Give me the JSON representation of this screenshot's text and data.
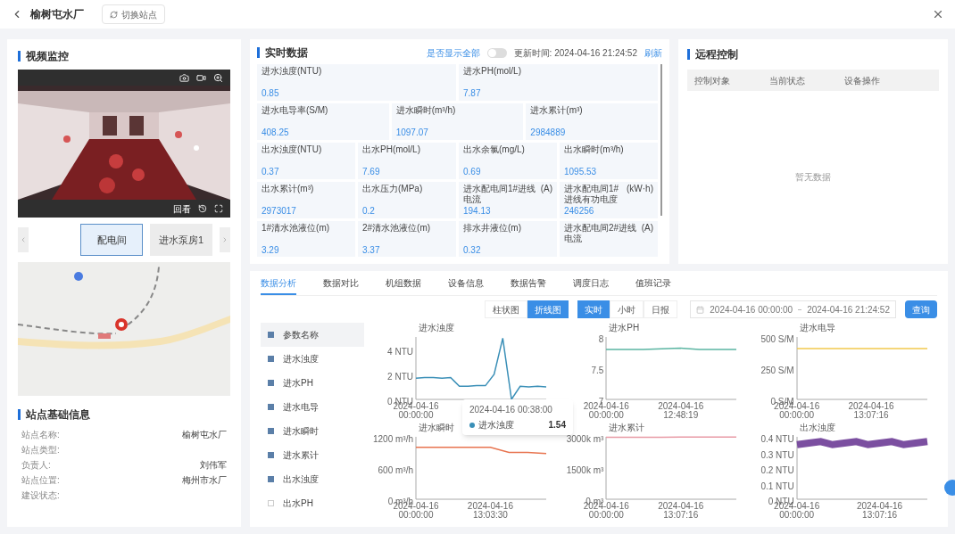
{
  "header": {
    "title": "榆树屯水厂",
    "switch_button": "切换站点"
  },
  "video_panel": {
    "title": "视频监控",
    "playback_label": "回看",
    "cameras": [
      {
        "label": "配电间",
        "selected": true
      },
      {
        "label": "进水泵房1",
        "selected": false
      }
    ]
  },
  "site_info": {
    "title": "站点基础信息",
    "fields": [
      {
        "label": "站点名称:",
        "value": "榆树屯水厂"
      },
      {
        "label": "站点类型:"
      },
      {
        "label": "负责人:",
        "value": "刘伟军"
      },
      {
        "label": "站点位置:",
        "value": "梅州市水厂"
      },
      {
        "label": "建设状态:"
      }
    ]
  },
  "realtime": {
    "title": "实时数据",
    "show_all_label": "是否显示全部",
    "show_all_on": false,
    "update_time": "更新时间: 2024-04-16 21:24:52",
    "refresh": "刷新",
    "items": [
      {
        "label": "进水浊度(NTU)",
        "value": "0.85"
      },
      {
        "label": "进水PH(mol/L)",
        "value": "7.87"
      },
      {
        "label": "进水电导率(S/M)",
        "value": "408.25"
      },
      {
        "label": "进水瞬时(m³/h)",
        "value": "1097.07"
      },
      {
        "label": "进水累计(m³)",
        "value": "2984889"
      },
      {
        "label": "出水浊度(NTU)",
        "value": "0.37"
      },
      {
        "label": "出水PH(mol/L)",
        "value": "7.69"
      },
      {
        "label": "出水余氯(mg/L)",
        "value": "0.69"
      },
      {
        "label": "出水瞬时(m³/h)",
        "value": "1095.53"
      },
      {
        "label": "出水累计(m³)",
        "value": "2973017"
      },
      {
        "label": "出水压力(MPa)",
        "value": "0.2"
      },
      {
        "label": "进水配电间1#进线电流",
        "unit": "(A)",
        "value": "194.13"
      },
      {
        "label": "进水配电间1#进线有功电度",
        "unit": "(kW·h)",
        "value": "246256"
      },
      {
        "label": "1#清水池液位(m)",
        "value": "3.29"
      },
      {
        "label": "2#清水池液位(m)",
        "value": "3.37"
      },
      {
        "label": "排水井液位(m)",
        "value": "0.32"
      },
      {
        "label": "进水配电间2#进线电流",
        "unit": "(A)"
      }
    ]
  },
  "remote_control": {
    "title": "远程控制",
    "columns": [
      "控制对象",
      "当前状态",
      "设备操作"
    ],
    "empty_text": "暂无数据"
  },
  "analysis": {
    "tabs": [
      {
        "label": "数据分析",
        "selected": true
      },
      {
        "label": "数据对比",
        "selected": false
      },
      {
        "label": "机组数据",
        "selected": false
      },
      {
        "label": "设备信息",
        "selected": false
      },
      {
        "label": "数据告警",
        "selected": false
      },
      {
        "label": "调度日志",
        "selected": false
      },
      {
        "label": "值班记录",
        "selected": false
      }
    ],
    "chart_types": [
      {
        "label": "柱状图",
        "selected": false
      },
      {
        "label": "折线图",
        "selected": true
      }
    ],
    "periods": [
      {
        "label": "实时",
        "selected": true
      },
      {
        "label": "小时",
        "selected": false
      },
      {
        "label": "日报",
        "selected": false
      }
    ],
    "date_start": "2024-04-16 00:00:00",
    "date_end": "2024-04-16 21:24:52",
    "query_button": "查询",
    "params_header": {
      "label": "参数名称",
      "checked": true
    },
    "params": [
      {
        "label": "进水浊度",
        "checked": true
      },
      {
        "label": "进水PH",
        "checked": true
      },
      {
        "label": "进水电导",
        "checked": true
      },
      {
        "label": "进水瞬时",
        "checked": true
      },
      {
        "label": "进水累计",
        "checked": true
      },
      {
        "label": "出水浊度",
        "checked": true
      },
      {
        "label": "出水PH",
        "checked": false
      }
    ],
    "charts": [
      {
        "chart_data": {
          "type": "line",
          "categories": [
            "2024-04-16 00:00:00",
            null,
            null,
            null,
            null,
            null,
            null,
            null,
            null,
            null,
            null,
            null,
            null,
            null,
            null,
            null
          ],
          "ylim": [
            0,
            5
          ],
          "yticks": [
            {
              "value": 0,
              "label": "0 NTU"
            },
            {
              "value": 2,
              "label": "2 NTU"
            },
            {
              "value": 4,
              "label": "4 NTU"
            }
          ],
          "series": [
            {
              "name": "进水浊度",
              "color": "#3a8fb7",
              "values": [
                1.7,
                1.75,
                1.75,
                1.7,
                1.75,
                1.05,
                1.05,
                1.1,
                1.1,
                2.0,
                4.9,
                0,
                1.05,
                1.0,
                1.05,
                1.0
              ]
            }
          ]
        }
      },
      {
        "chart_data": {
          "type": "line",
          "categories": [
            "2024-04-16 00:00:00",
            null,
            null,
            null,
            "2024-04-16 12:48:19",
            null,
            null,
            null
          ],
          "ylim": [
            7,
            8
          ],
          "yticks": [
            {
              "value": 7,
              "label": "7"
            },
            {
              "value": 7.5,
              "label": "7.5"
            },
            {
              "value": 8,
              "label": "8"
            }
          ],
          "series": [
            {
              "name": "进水PH",
              "color": "#5bb5a2",
              "values": [
                7.8,
                7.8,
                7.8,
                7.81,
                7.82,
                7.8,
                7.8,
                7.8
              ]
            }
          ]
        }
      },
      {
        "chart_data": {
          "type": "line",
          "categories": [
            "2024-04-16 00:00:00",
            null,
            null,
            null,
            "2024-04-16 13:07:16",
            null,
            null,
            null
          ],
          "ylim": [
            0,
            500
          ],
          "yticks": [
            {
              "value": 0,
              "label": "0 S/M"
            },
            {
              "value": 250,
              "label": "250 S/M"
            },
            {
              "value": 500,
              "label": "500 S/M"
            }
          ],
          "series": [
            {
              "name": "进水电导",
              "color": "#f2c94c",
              "values": [
                408,
                408,
                408,
                408,
                408,
                408,
                408,
                408
              ]
            }
          ]
        }
      },
      {
        "chart_data": {
          "type": "line",
          "categories": [
            "2024-04-16 00:00:00",
            null,
            null,
            null,
            "2024-04-16 13:03:30",
            null,
            null,
            null
          ],
          "ylim": [
            0,
            1200
          ],
          "yticks": [
            {
              "value": 0,
              "label": "0 m³/h"
            },
            {
              "value": 600,
              "label": "600 m³/h"
            },
            {
              "value": 1200,
              "label": "1200 m³/h"
            }
          ],
          "series": [
            {
              "name": "进水瞬时",
              "color": "#e8744f",
              "values": [
                1000,
                1000,
                1000,
                1000,
                1000,
                900,
                900,
                880
              ]
            }
          ]
        }
      },
      {
        "chart_data": {
          "type": "line",
          "categories": [
            "2024-04-16 00:00:00",
            null,
            null,
            null,
            "2024-04-16 13:07:16",
            null,
            null,
            null
          ],
          "ylim": [
            0,
            3000000
          ],
          "yticks": [
            {
              "value": 0,
              "label": "0 m³"
            },
            {
              "value": 1500000,
              "label": "1500k m³"
            },
            {
              "value": 3000000,
              "label": "3000k m³"
            }
          ],
          "series": [
            {
              "name": "进水累计",
              "color": "#e89aa5",
              "values": [
                2980000,
                2980000,
                2980000,
                2980000,
                2990000,
                2990000,
                2990000,
                2990000
              ]
            }
          ]
        }
      },
      {
        "chart_data": {
          "type": "line",
          "categories": [
            "2024-04-16 00:00:00",
            null,
            null,
            null,
            null,
            null,
            null,
            "2024-04-16 13:07:16",
            null,
            null,
            null,
            null
          ],
          "ylim": [
            0,
            0.4
          ],
          "yticks": [
            {
              "value": 0,
              "label": "0 NTU"
            },
            {
              "value": 0.1,
              "label": "0.1 NTU"
            },
            {
              "value": 0.2,
              "label": "0.2 NTU"
            },
            {
              "value": 0.3,
              "label": "0.3 NTU"
            },
            {
              "value": 0.4,
              "label": "0.4 NTU"
            }
          ],
          "series": [
            {
              "name": "出水浊度",
              "color": "#7b4fa0",
              "values": [
                0.35,
                0.36,
                0.37,
                0.35,
                0.36,
                0.37,
                0.35,
                0.36,
                0.37,
                0.35,
                0.36,
                0.37
              ]
            }
          ]
        }
      }
    ],
    "tooltip": {
      "time": "2024-04-16 00:38:00",
      "series": "进水浊度",
      "value": "1.54",
      "color": "#3a8fb7"
    }
  }
}
